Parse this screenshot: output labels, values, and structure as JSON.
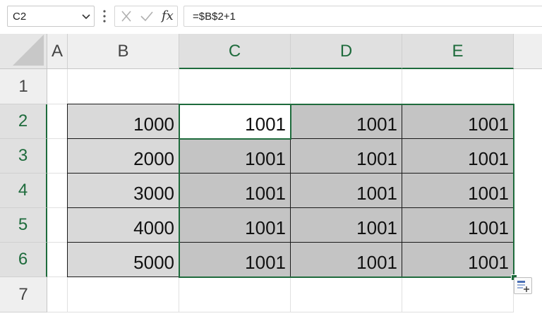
{
  "formula_bar": {
    "name_box": "C2",
    "formula": "=$B$2+1",
    "fx_label": "fx"
  },
  "columns": [
    "A",
    "B",
    "C",
    "D",
    "E"
  ],
  "rows": [
    "1",
    "2",
    "3",
    "4",
    "5",
    "6",
    "7"
  ],
  "cells": {
    "B2": "1000",
    "C2": "1001",
    "D2": "1001",
    "E2": "1001",
    "B3": "2000",
    "C3": "1001",
    "D3": "1001",
    "E3": "1001",
    "B4": "3000",
    "C4": "1001",
    "D4": "1001",
    "E4": "1001",
    "B5": "4000",
    "C5": "1001",
    "D5": "1001",
    "E5": "1001",
    "B6": "5000",
    "C6": "1001",
    "D6": "1001",
    "E6": "1001"
  },
  "selection": {
    "range": "C2:E6",
    "active_cell": "C2",
    "accent_color": "#1e6b3c"
  },
  "icons": {
    "name_box_dropdown": "chevron-down-icon",
    "more_options": "vertical-dots-icon",
    "cancel": "x-icon",
    "enter": "check-icon",
    "insert_function": "fx-icon",
    "quick_analysis": "quick-analysis-icon"
  }
}
